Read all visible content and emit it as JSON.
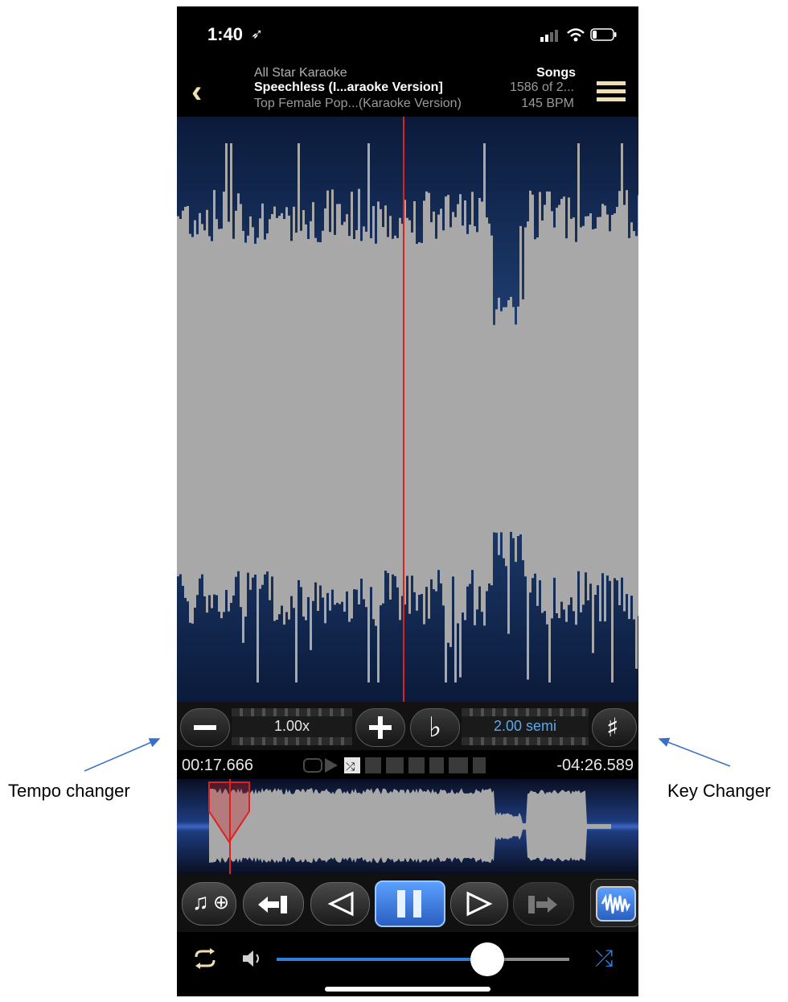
{
  "status": {
    "time": "1:40"
  },
  "header": {
    "app": "All Star Karaoke",
    "title": "Speechless (I...araoke Version]",
    "subtitle": "Top Female Pop...(Karaoke Version)",
    "section": "Songs",
    "position": "1586 of 2...",
    "bpm": "145 BPM"
  },
  "tempo": {
    "value": "1.00x"
  },
  "key": {
    "value": "2.00 semi"
  },
  "times": {
    "elapsed": "00:17.666",
    "remaining": "-04:26.589"
  },
  "playback": {
    "volume": 0.72
  },
  "annotations": {
    "left": "Tempo  changer",
    "right": "Key Changer"
  },
  "colors": {
    "accent": "#f0dfae",
    "waveform": "#a8a8a8",
    "playhead": "#e02020",
    "key_value": "#5aa9f0",
    "slider": "#2f7ed8"
  }
}
